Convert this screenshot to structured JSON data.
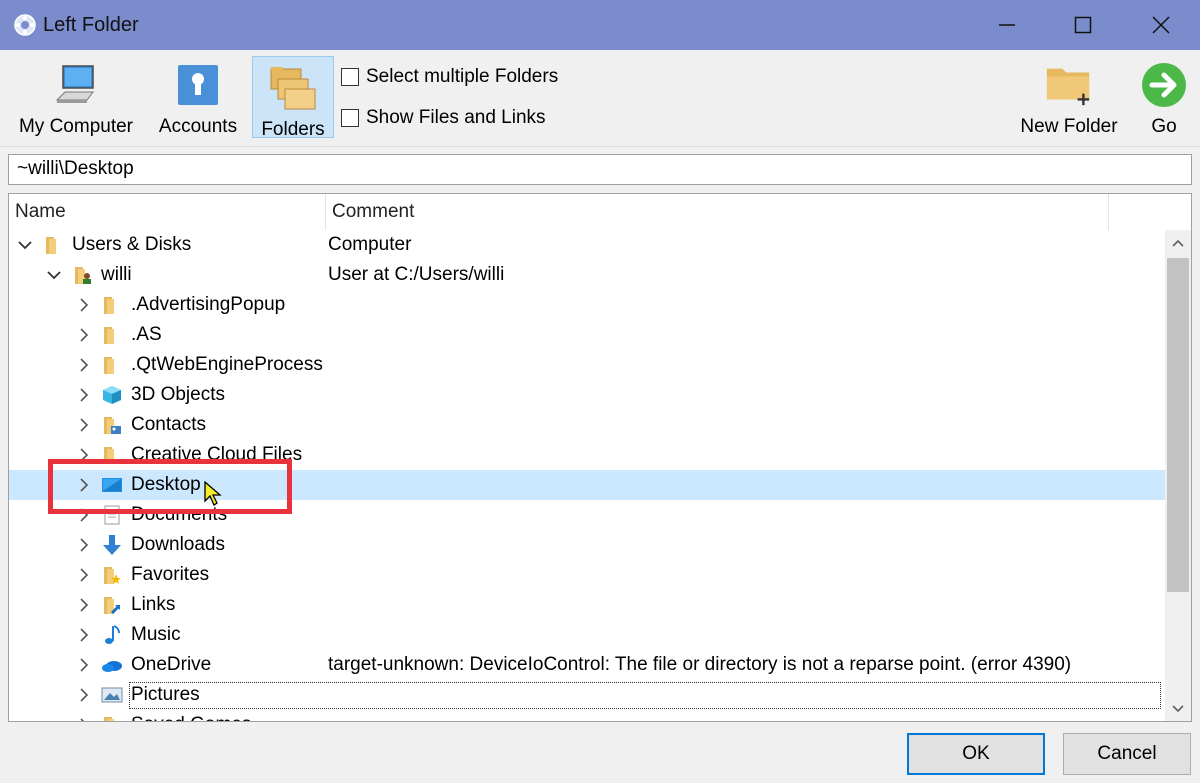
{
  "window": {
    "title": "Left Folder",
    "minimize_icon": "minimize-icon",
    "maximize_icon": "maximize-icon",
    "close_icon": "close-icon"
  },
  "toolbar": {
    "my_computer": "My Computer",
    "accounts": "Accounts",
    "folders": "Folders",
    "select_multiple": "Select multiple Folders",
    "show_files": "Show Files and Links",
    "new_folder": "New Folder",
    "go": "Go"
  },
  "path": "~willi\\Desktop",
  "columns": {
    "name": "Name",
    "comment": "Comment"
  },
  "tree": [
    {
      "name": "Users & Disks",
      "comment": "Computer",
      "icon": "folder-icon"
    },
    {
      "name": "willi",
      "comment": "User at C:/Users/willi",
      "icon": "user-folder-icon"
    },
    {
      "name": ".AdvertisingPopup",
      "comment": "",
      "icon": "folder-icon"
    },
    {
      "name": ".AS",
      "comment": "",
      "icon": "folder-icon"
    },
    {
      "name": ".QtWebEngineProcess",
      "comment": "",
      "icon": "folder-icon"
    },
    {
      "name": "3D Objects",
      "comment": "",
      "icon": "3d-objects-icon"
    },
    {
      "name": "Contacts",
      "comment": "",
      "icon": "contacts-icon"
    },
    {
      "name": "Creative Cloud Files",
      "comment": "",
      "icon": "creative-cloud-icon"
    },
    {
      "name": "Desktop",
      "comment": "",
      "icon": "desktop-icon"
    },
    {
      "name": "Documents",
      "comment": "",
      "icon": "documents-icon"
    },
    {
      "name": "Downloads",
      "comment": "",
      "icon": "downloads-icon"
    },
    {
      "name": "Favorites",
      "comment": "",
      "icon": "favorites-icon"
    },
    {
      "name": "Links",
      "comment": "",
      "icon": "links-icon"
    },
    {
      "name": "Music",
      "comment": "",
      "icon": "music-icon"
    },
    {
      "name": "OneDrive",
      "comment": "target-unknown: DeviceIoControl: The file or directory is not a reparse point.  (error 4390)",
      "icon": "onedrive-icon"
    },
    {
      "name": "Pictures",
      "comment": "",
      "icon": "pictures-icon"
    },
    {
      "name": "Saved Games",
      "comment": "",
      "icon": "saved-games-icon"
    }
  ],
  "buttons": {
    "ok": "OK",
    "cancel": "Cancel"
  }
}
